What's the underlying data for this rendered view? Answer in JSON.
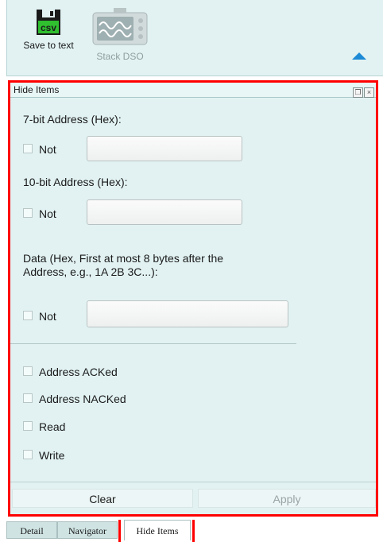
{
  "toolbar": {
    "save_label": "Save to text",
    "save_icon_text": "CSV",
    "dso_label": "Stack DSO"
  },
  "panel": {
    "title": "Hide Items",
    "addr7_label": "7-bit Address (Hex):",
    "addr10_label": "10-bit Address (Hex):",
    "data_label_line1": "Data (Hex, First at most 8 bytes after the",
    "data_label_line2": "Address, e.g., 1A 2B 3C...):",
    "not_label": "Not",
    "addr7_value": "",
    "addr10_value": "",
    "data_value": "",
    "options": [
      "Address ACKed",
      "Address NACKed",
      "Read",
      "Write"
    ],
    "clear_label": "Clear",
    "apply_label": "Apply"
  },
  "tabs": {
    "detail": "Detail",
    "navigator": "Navigator",
    "hide_items": "Hide Items"
  },
  "colors": {
    "panel_bg": "#e2f2f2",
    "highlight": "#ff0000",
    "accent": "#1d8ad6"
  }
}
